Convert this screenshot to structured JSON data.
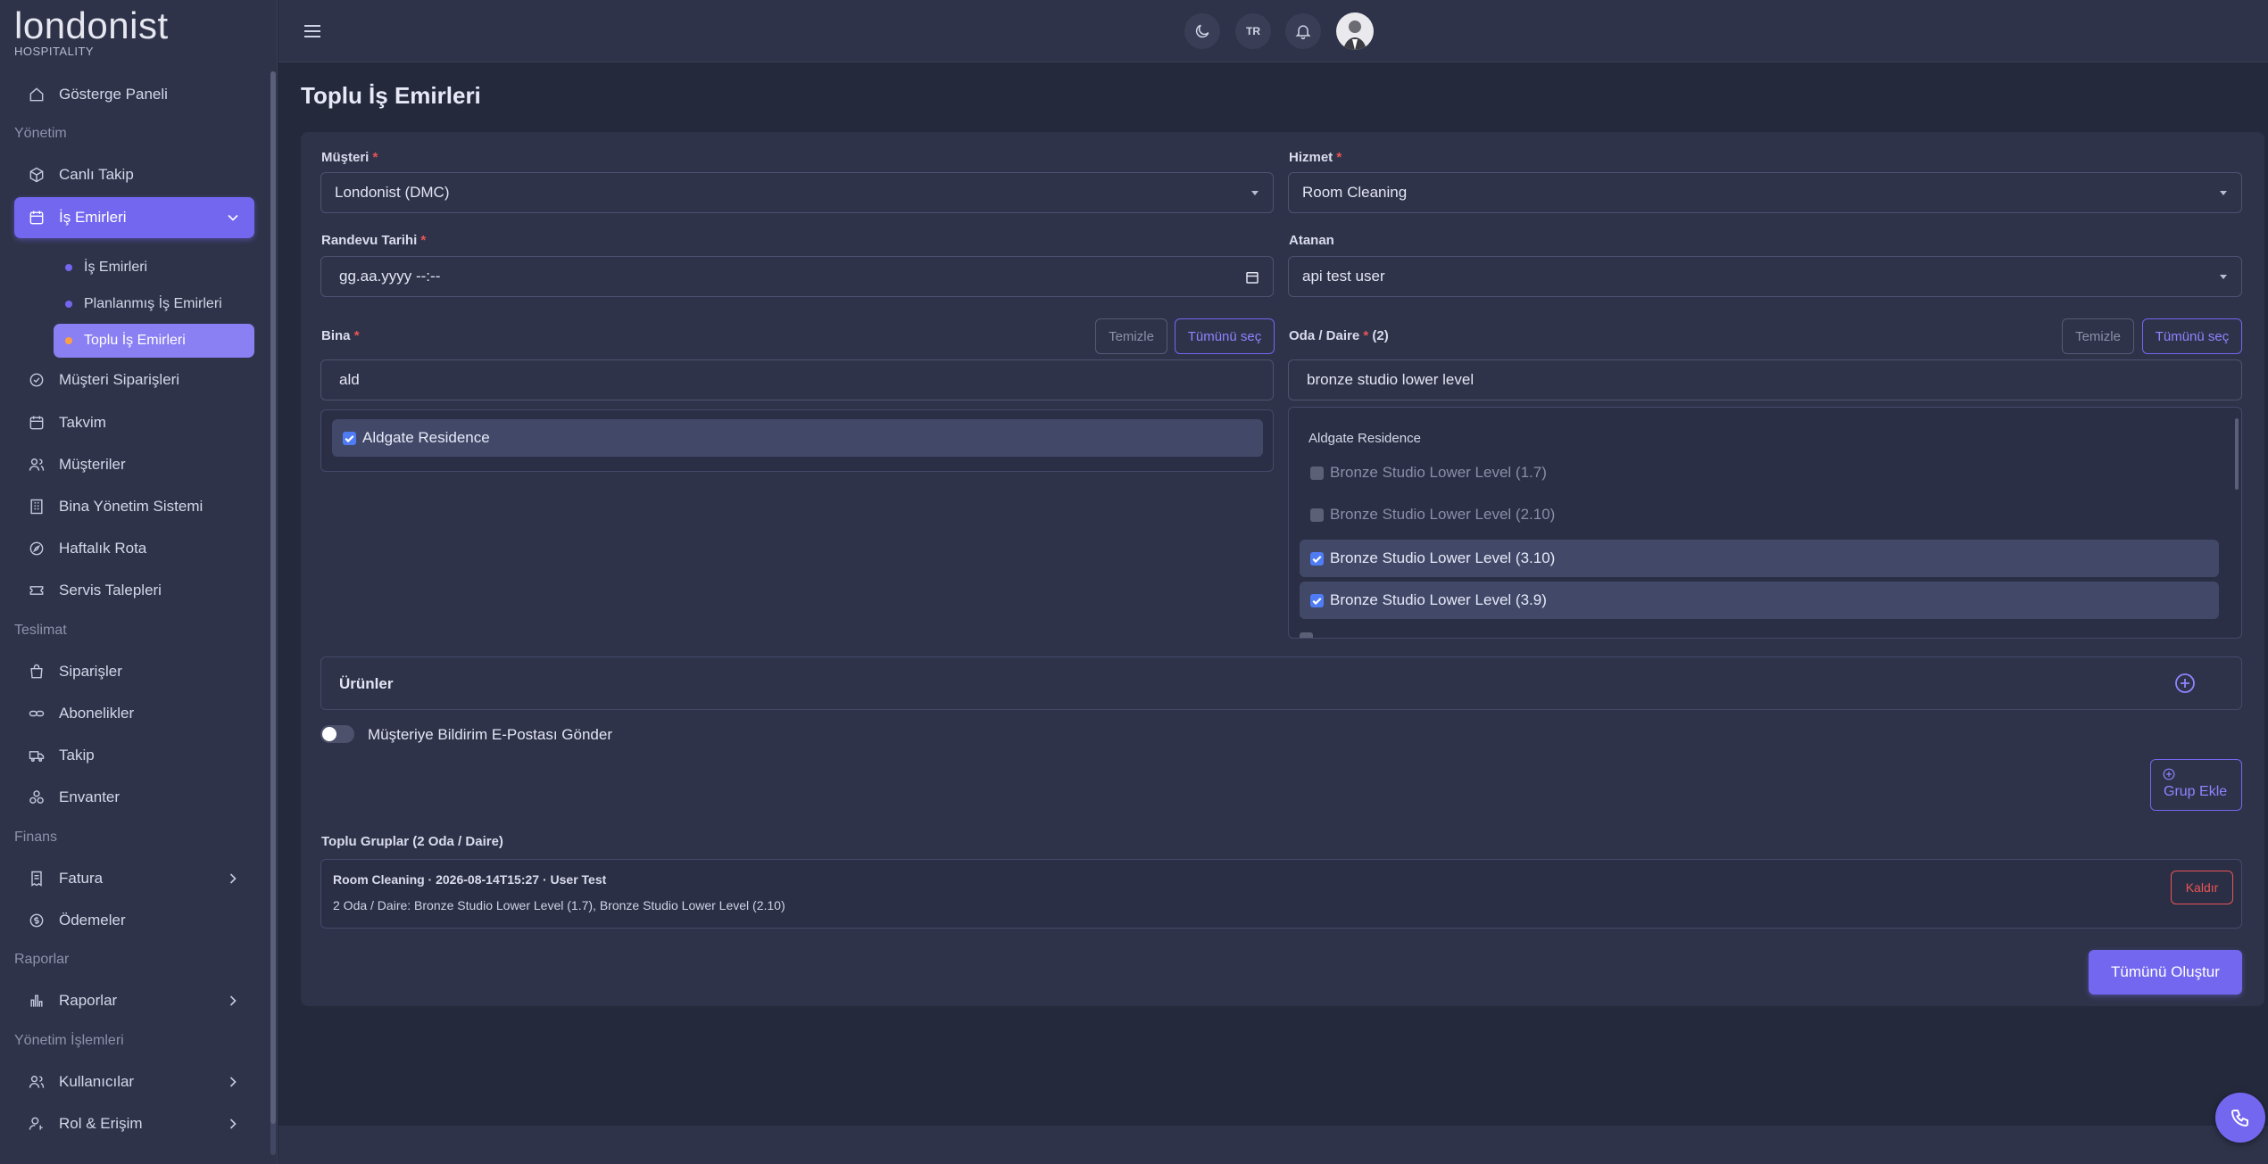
{
  "brand": {
    "name": "londonist",
    "tagline": "HOSPITALITY",
    "accent": "#7367f0"
  },
  "sidebar": {
    "dashboard": "Gösterge Paneli",
    "sections": {
      "management": "Yönetim",
      "delivery": "Teslimat",
      "finance": "Finans",
      "reports": "Raporlar",
      "admin": "Yönetim İşlemleri"
    },
    "items": {
      "live_tracking": "Canlı Takip",
      "work_orders": "İş Emirleri",
      "customer_orders": "Müşteri Siparişleri",
      "calendar": "Takvim",
      "customers": "Müşteriler",
      "building_mgmt": "Bina Yönetim Sistemi",
      "weekly_route": "Haftalık Rota",
      "service_requests": "Servis Talepleri",
      "orders": "Siparişler",
      "subscriptions": "Abonelikler",
      "tracking": "Takip",
      "inventory": "Envanter",
      "invoice": "Fatura",
      "payments": "Ödemeler",
      "reports": "Raporlar",
      "users": "Kullanıcılar",
      "roles": "Rol & Erişim"
    },
    "sub_items": {
      "work_orders": "İş Emirleri",
      "planned": "Planlanmış İş Emirleri",
      "bulk": "Toplu İş Emirleri"
    }
  },
  "topbar": {
    "language": "TR"
  },
  "page": {
    "title": "Toplu İş Emirleri",
    "customer": {
      "label": "Müşteri",
      "value": "Londonist (DMC)"
    },
    "service": {
      "label": "Hizmet",
      "value": "Room Cleaning"
    },
    "appointment": {
      "label": "Randevu Tarihi",
      "placeholder": "gg.aa.yyyy --:--"
    },
    "assignee": {
      "label": "Atanan",
      "value": "api test user"
    },
    "building": {
      "label": "Bina",
      "clear": "Temizle",
      "select_all": "Tümünü seç",
      "search": "ald",
      "options": [
        {
          "label": "Aldgate Residence",
          "checked": true
        }
      ]
    },
    "room": {
      "label": "Oda / Daire",
      "count": "(2)",
      "clear": "Temizle",
      "select_all": "Tümünü seç",
      "search": "bronze studio lower level",
      "group_header": "Aldgate Residence",
      "options": [
        {
          "label": "Bronze Studio Lower Level (1.7)",
          "state": "disabled"
        },
        {
          "label": "Bronze Studio Lower Level (2.10)",
          "state": "disabled"
        },
        {
          "label": "Bronze Studio Lower Level (3.10)",
          "state": "checked"
        },
        {
          "label": "Bronze Studio Lower Level (3.9)",
          "state": "checked"
        }
      ]
    },
    "products": {
      "label": "Ürünler"
    },
    "notify": {
      "label": "Müşteriye Bildirim E-Postası Gönder",
      "on": false
    },
    "add_group": "Grup Ekle",
    "groups": {
      "title": "Toplu Gruplar (2 Oda / Daire)",
      "items": [
        {
          "summary": "Room Cleaning · 2026-08-14T15:27 · User Test",
          "detail": "2 Oda / Daire: Bronze Studio Lower Level (1.7), Bronze Studio Lower Level (2.10)",
          "remove": "Kaldır"
        }
      ]
    },
    "create_all": "Tümünü Oluştur"
  }
}
